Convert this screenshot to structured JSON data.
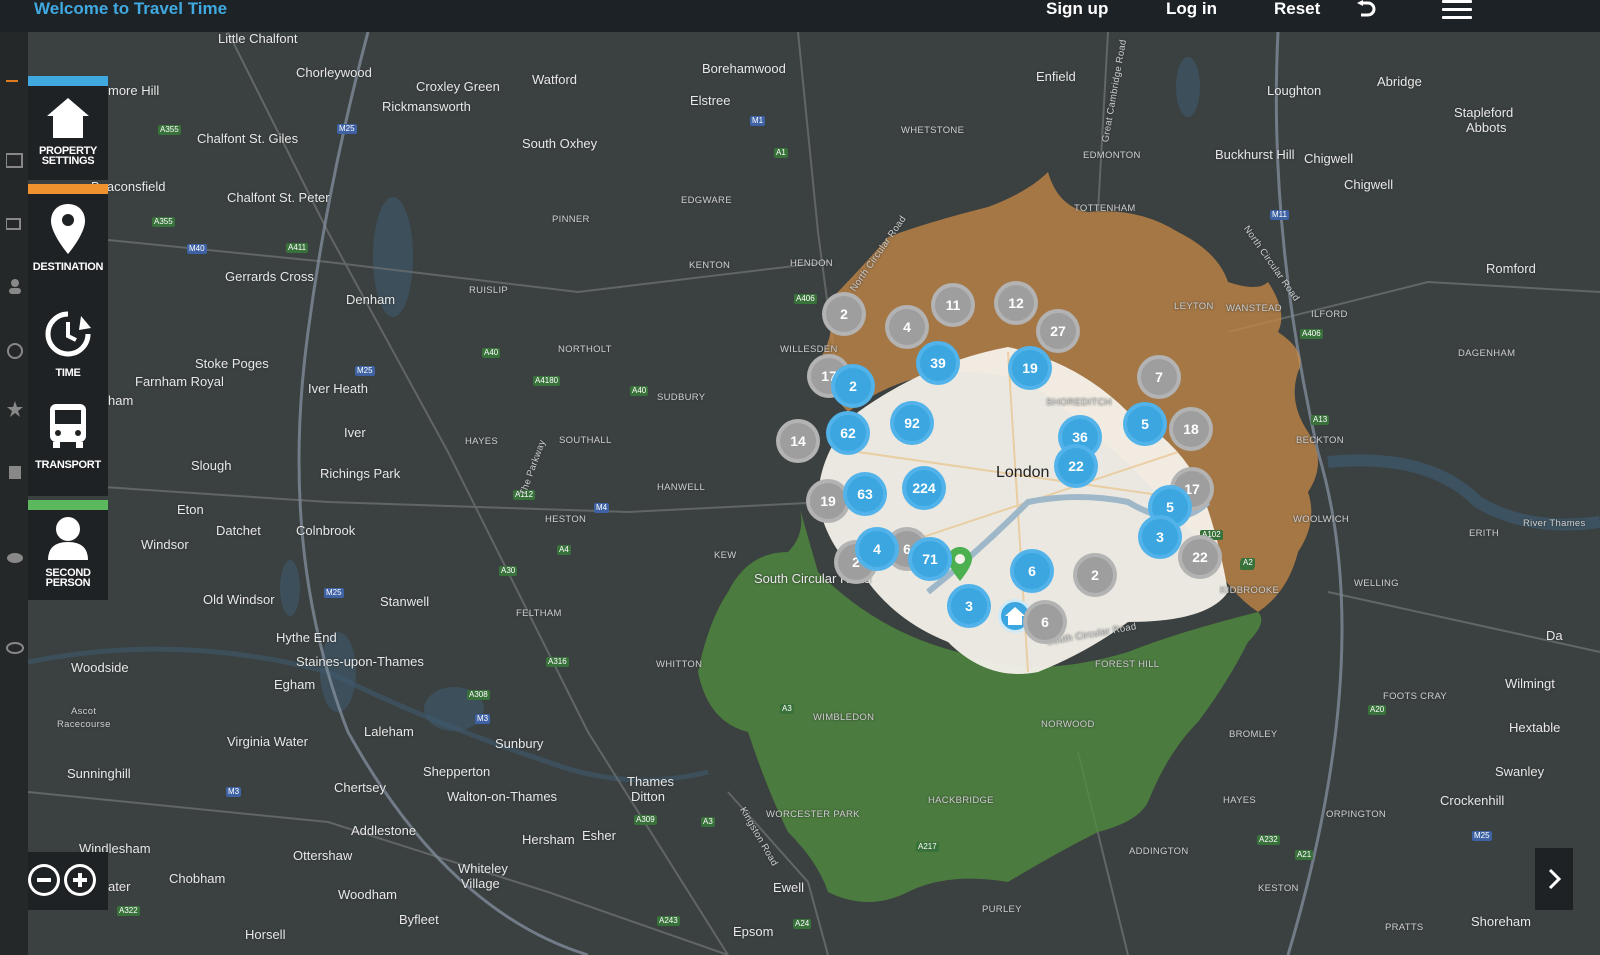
{
  "header": {
    "title": "Welcome to Travel Time",
    "signup_label": "Sign up",
    "login_label": "Log in",
    "reset_label": "Reset"
  },
  "sidebar": {
    "items": [
      {
        "label_line1": "PROPERTY",
        "label_line2": "SETTINGS",
        "accent": "#3fa9e0",
        "icon": "house-icon"
      },
      {
        "label_line1": "DESTINATION",
        "label_line2": "",
        "accent": "#f0932e",
        "icon": "map-pin-icon"
      },
      {
        "label_line1": "TIME",
        "label_line2": "",
        "accent": "",
        "icon": "clock-icon"
      },
      {
        "label_line1": "TRANSPORT",
        "label_line2": "",
        "accent": "",
        "icon": "bus-icon"
      },
      {
        "label_line1": "SECOND",
        "label_line2": "PERSON",
        "accent": "#5cb85c",
        "icon": "person-icon"
      }
    ]
  },
  "map": {
    "colors": {
      "orange_zone": "#c98a47",
      "green_zone": "#4f8c3e",
      "center_zone": "#f4f1ea",
      "cluster_blue": "#3ba6e0",
      "cluster_grey": "#9e9e9e"
    },
    "places": [
      "Little Chalfont",
      "Chorleywood",
      "Croxley Green",
      "Watford",
      "Borehamwood",
      "Enfield",
      "Loughton",
      "Abridge",
      "more Hill",
      "Rickmansworth",
      "Elstree",
      "Stapleford",
      "Abbots",
      "Chalfont St. Giles",
      "South Oxhey",
      "WHETSTONE",
      "EDMONTON",
      "Buckhurst Hill",
      "Chigwell",
      "Beaconsfield",
      "Chalfont St. Peter",
      "PINNER",
      "EDGWARE",
      "TOTTENHAM",
      "Chigwell",
      "KENTON",
      "HENDON",
      "Romford",
      "Gerrards Cross",
      "RUISLIP",
      "Denham",
      "LEYTON",
      "WANSTEAD",
      "ILFORD",
      "NORTHOLT",
      "WILLESDEN",
      "DAGENHAM",
      "Stoke Poges",
      "Farnham Royal",
      "Iver Heath",
      "SUDBURY",
      "SHOREDITCH",
      "ham",
      "Iver",
      "HAYES",
      "SOUTHALL",
      "BECKTON",
      "Slough",
      "Richings Park",
      "London",
      "Eton",
      "HANWELL",
      "HESTON",
      "Windsor",
      "Datchet",
      "Colnbrook",
      "WOOLWICH",
      "ERITH",
      "River Thames",
      "KEW",
      "South Circular Road",
      "Old Windsor",
      "Stanwell",
      "FELTHAM",
      "KIDBROOKE",
      "WELLING",
      "Da",
      "Hythe End",
      "Woodside",
      "Staines-upon-Thames",
      "WHITTON",
      "FOREST HILL",
      "Egham",
      "Wilmingt",
      "Ascot",
      "Racecourse",
      "WIMBLEDON",
      "NORWOOD",
      "BROMLEY",
      "FOOTS CRAY",
      "Hextable",
      "Virginia Water",
      "Laleham",
      "Sunbury",
      "Swanley",
      "Sunninghill",
      "Shepperton",
      "HACKBRIDGE",
      "HAYES",
      "Chertsey",
      "Walton-on-Thames",
      "Thames",
      "Ditton",
      "WORCESTER PARK",
      "ORPINGTON",
      "Crockenhill",
      "Windlesham",
      "Addlestone",
      "Hersham",
      "Esher",
      "ADDINGTON",
      "Ottershaw",
      "Whiteley",
      "Village",
      "ater",
      "Chobham",
      "Ewell",
      "KESTON",
      "Woodham",
      "PURLEY",
      "Byfleet",
      "Shoreham",
      "Epsom",
      "PRATTS",
      "Horsell"
    ],
    "roads": [
      "A355",
      "M25",
      "M1",
      "A1",
      "A406",
      "A411",
      "A355",
      "M40",
      "A40",
      "M25",
      "A4180",
      "A40",
      "A112",
      "M4",
      "A4",
      "A30",
      "M25",
      "A316",
      "A308",
      "M3",
      "A3",
      "M3",
      "A309",
      "A3",
      "A232",
      "A21",
      "M25",
      "A20",
      "A2",
      "A13",
      "A406",
      "M11",
      "A243",
      "A24",
      "A322",
      "A217",
      "A102",
      "A2",
      "Chalfont"
    ],
    "road_names": [
      "North Circular Road",
      "North Circular Road",
      "Great Cambridge Road",
      "The Parkway",
      "South Circular Road",
      "South Circular Road",
      "Kingston Road"
    ],
    "clusters": [
      {
        "count": "2",
        "color": "grey"
      },
      {
        "count": "4",
        "color": "grey"
      },
      {
        "count": "11",
        "color": "grey"
      },
      {
        "count": "12",
        "color": "grey"
      },
      {
        "count": "27",
        "color": "grey"
      },
      {
        "count": "17",
        "color": "grey"
      },
      {
        "count": "2",
        "color": "blue"
      },
      {
        "count": "39",
        "color": "blue"
      },
      {
        "count": "19",
        "color": "blue"
      },
      {
        "count": "7",
        "color": "grey"
      },
      {
        "count": "14",
        "color": "grey"
      },
      {
        "count": "62",
        "color": "blue"
      },
      {
        "count": "92",
        "color": "blue"
      },
      {
        "count": "36",
        "color": "blue"
      },
      {
        "count": "5",
        "color": "blue"
      },
      {
        "count": "18",
        "color": "grey"
      },
      {
        "count": "22",
        "color": "blue"
      },
      {
        "count": "19",
        "color": "grey"
      },
      {
        "count": "63",
        "color": "blue"
      },
      {
        "count": "224",
        "color": "blue"
      },
      {
        "count": "17",
        "color": "grey"
      },
      {
        "count": "5",
        "color": "blue"
      },
      {
        "count": "3",
        "color": "blue"
      },
      {
        "count": "22",
        "color": "grey"
      },
      {
        "count": "2",
        "color": "grey"
      },
      {
        "count": "6",
        "color": "grey"
      },
      {
        "count": "4",
        "color": "blue"
      },
      {
        "count": "71",
        "color": "blue"
      },
      {
        "count": "6",
        "color": "blue"
      },
      {
        "count": "2",
        "color": "grey"
      },
      {
        "count": "3",
        "color": "blue"
      },
      {
        "count": "6",
        "color": "grey"
      }
    ]
  },
  "controls": {
    "zoom_out": "zoom-out",
    "zoom_in": "zoom-in",
    "next": "next-panel"
  }
}
